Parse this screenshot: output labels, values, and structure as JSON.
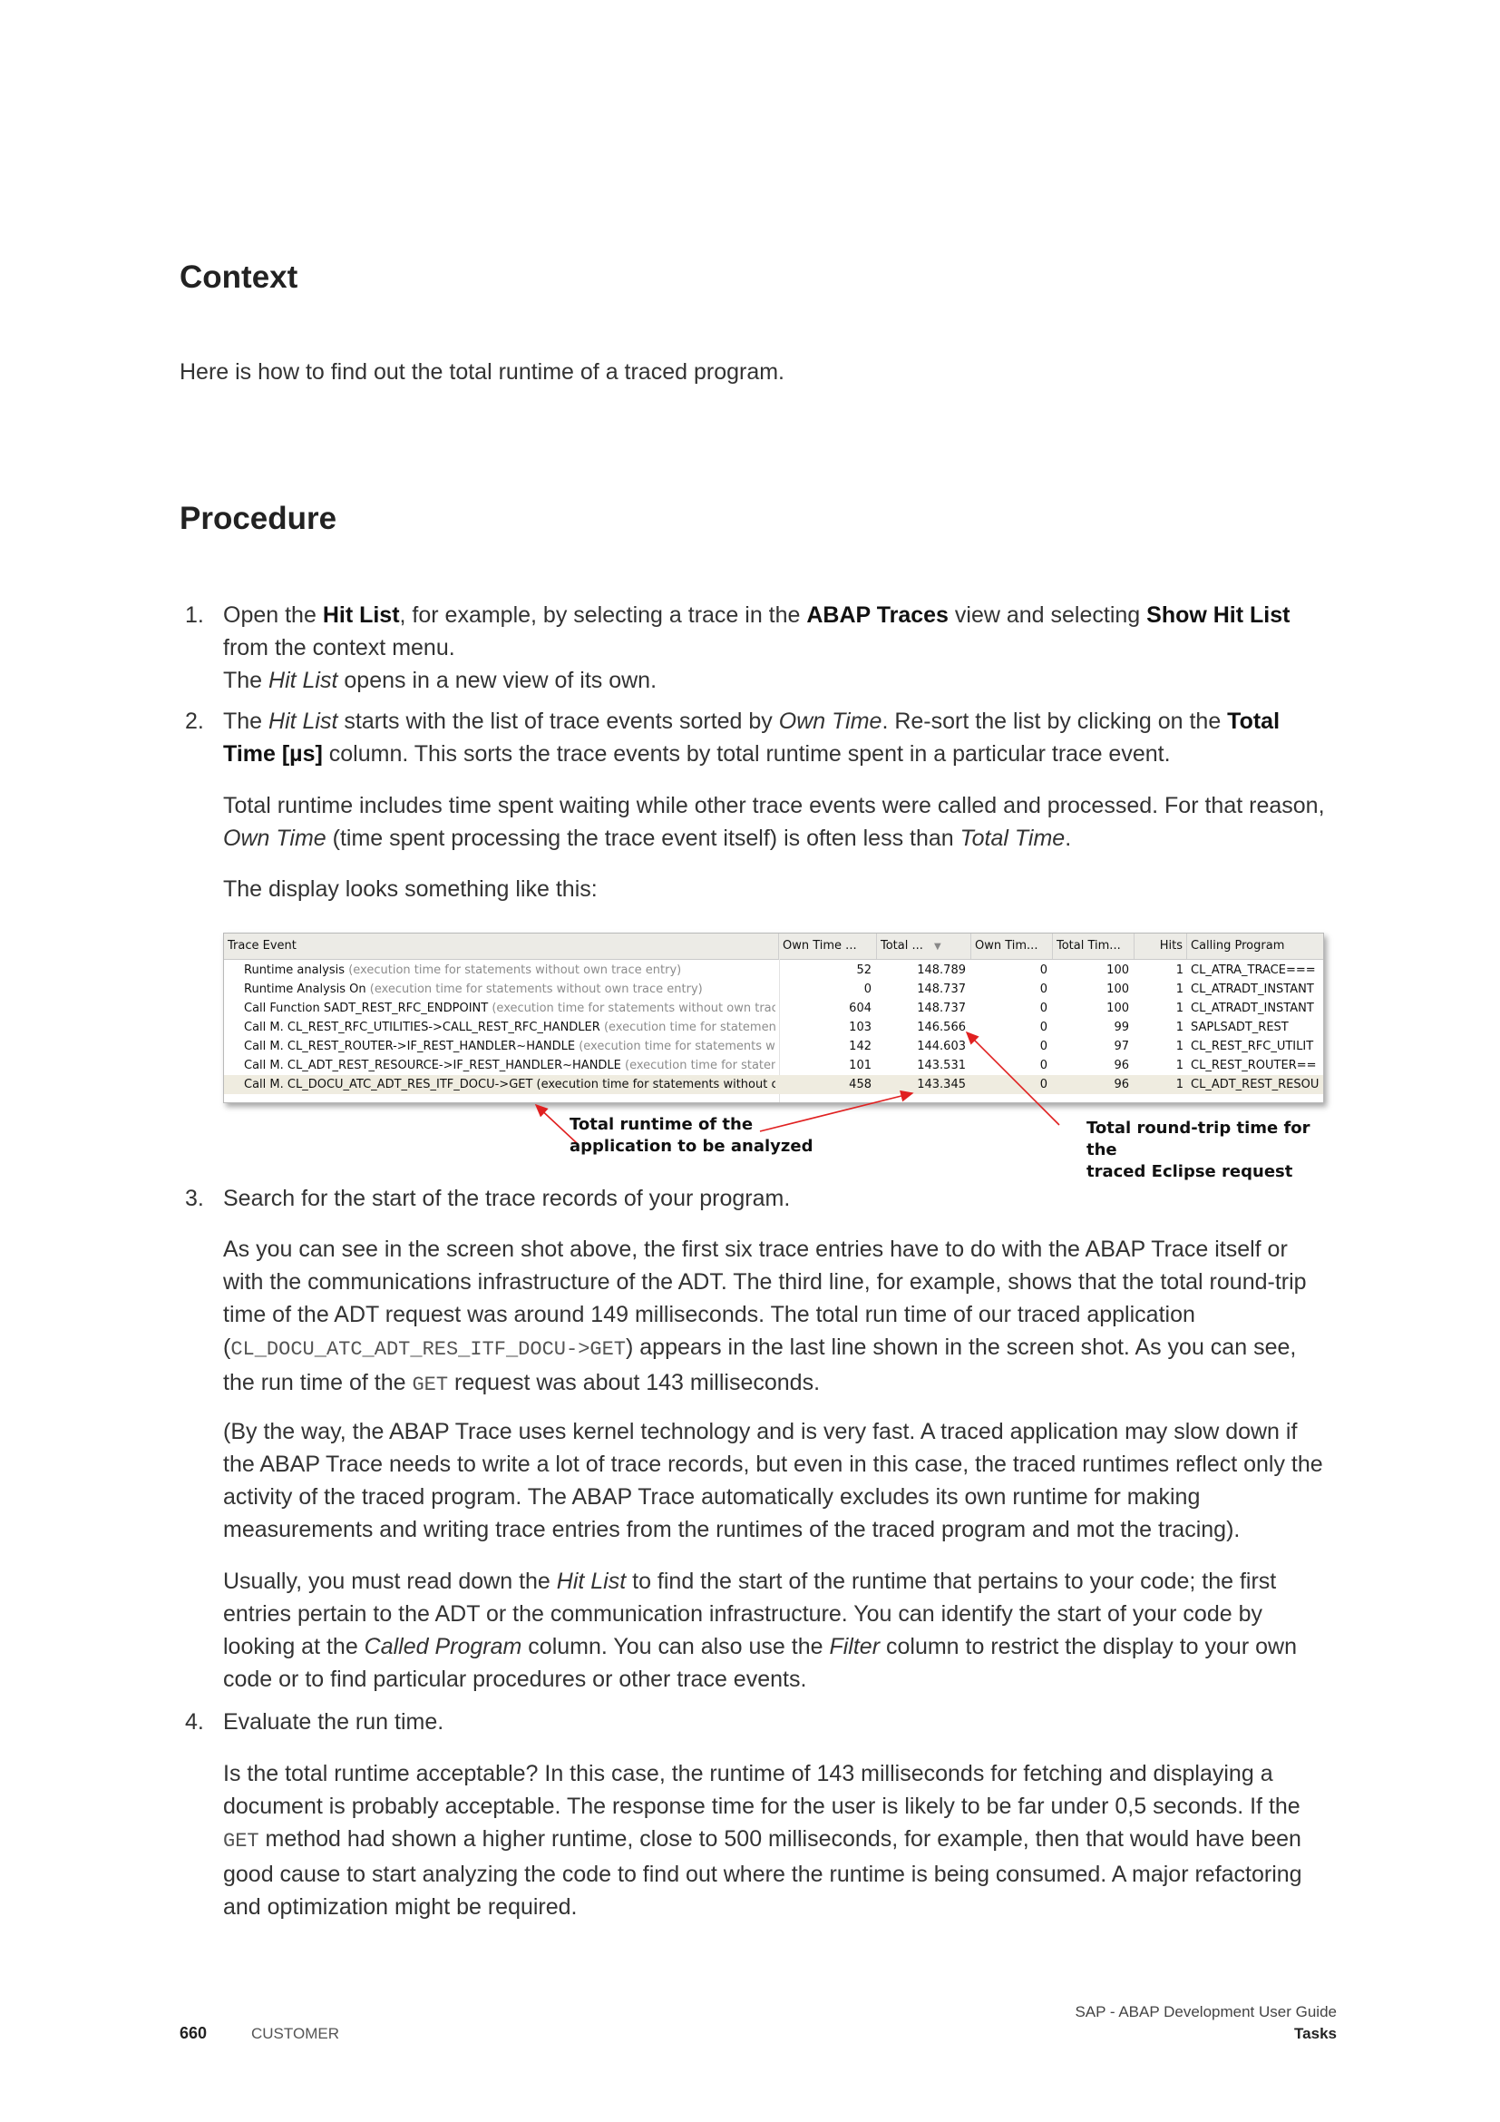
{
  "context": {
    "heading": "Context",
    "text": "Here is how to find out the total runtime of a traced program."
  },
  "procedure": {
    "heading": "Procedure",
    "step1": {
      "num": "1.",
      "a": "Open the ",
      "b1": "Hit List",
      "c": ", for example, by selecting a trace in the ",
      "b2": "ABAP Traces",
      "d": " view and selecting ",
      "b3": "Show Hit List",
      "e": " from the context menu.",
      "line2a": "The ",
      "line2i": "Hit List",
      "line2b": " opens in a new view of its own."
    },
    "step2": {
      "num": "2.",
      "a": "The ",
      "i1": "Hit List",
      "b": " starts with the list of trace events sorted by ",
      "i2": "Own Time",
      "c": ". Re-sort the list by clicking on the ",
      "b1": "Total Time [µs]",
      "d": " column. This sorts the trace events by total runtime spent in a particular trace event.",
      "p2a": "Total runtime includes time spent waiting while other trace events were called and processed. For that reason, ",
      "p2i1": "Own Time",
      "p2b": " (time spent processing the trace event itself) is often less than ",
      "p2i2": "Total Time",
      "p2c": ".",
      "p3": "The display looks something like this:"
    },
    "step3": {
      "num": "3.",
      "title": "Search for the start of the trace records of your program.",
      "p1a": "As you can see in the screen shot above, the first six trace entries have to do with the ABAP Trace itself or with the communications infrastructure of the ADT. The third line, for example, shows that the total round-trip time of the ADT request was around 149 milliseconds. The total run time of our traced application (",
      "p1code": "CL_DOCU_ATC_ADT_RES_ITF_DOCU->GET",
      "p1b": ") appears in the last line shown in the screen shot. As you can see, the run time of the ",
      "p1code2": "GET",
      "p1c": " request was about 143 milliseconds.",
      "p2": "(By the way, the ABAP Trace uses kernel technology and is very fast. A traced application may slow down if the ABAP Trace needs to write a lot of trace records, but even in this case, the traced runtimes reflect only the activity of the traced program. The ABAP Trace automatically excludes its own runtime for making measurements and writing trace entries from the runtimes of the traced program and mot the tracing).",
      "p3a": "Usually, you must read down the ",
      "p3i1": "Hit List",
      "p3b": " to find the start of the runtime that pertains to your code; the first entries pertain to the ADT or the communication infrastructure. You can identify the start of your code by looking at the ",
      "p3i2": "Called Program",
      "p3c": " column. You can also use the ",
      "p3i3": "Filter",
      "p3d": " column to restrict the display to your own code or to find particular procedures or other trace events."
    },
    "step4": {
      "num": "4.",
      "title": "Evaluate the run time.",
      "p1a": "Is the total runtime acceptable? In this case, the runtime of 143 milliseconds for fetching and displaying a document is probably acceptable. The response time for the user is likely to be far under 0,5 seconds. If the ",
      "p1code": "GET",
      "p1b": " method had shown a higher runtime, close to 500 milliseconds, for example, then that would have been good cause to start analyzing the code to find out where the runtime is being consumed. A major refactoring and optimization might be required."
    }
  },
  "screenshot": {
    "headers": [
      "Trace Event",
      "Own Time ...",
      "Total ...",
      "Own Tim...",
      "Total Tim...",
      "Hits",
      "Calling Program"
    ],
    "sort_icon": "sort-descending-icon",
    "rows": [
      {
        "event": "Runtime analysis",
        "note": "(execution time for statements without own trace entry)",
        "own": "52",
        "total": "148.789",
        "own2": "0",
        "total2": "100",
        "hits": "1",
        "prog": "CL_ATRA_TRACE==="
      },
      {
        "event": "Runtime Analysis On",
        "note": "(execution time for statements without own trace entry)",
        "own": "0",
        "total": "148.737",
        "own2": "0",
        "total2": "100",
        "hits": "1",
        "prog": "CL_ATRADT_INSTANT"
      },
      {
        "event": "Call Function  SADT_REST_RFC_ENDPOINT",
        "note": "(execution time for statements without own trace",
        "own": "604",
        "total": "148.737",
        "own2": "0",
        "total2": "100",
        "hits": "1",
        "prog": "CL_ATRADT_INSTANT"
      },
      {
        "event": "Call M.  CL_REST_RFC_UTILITIES->CALL_REST_RFC_HANDLER",
        "note": "(execution time for statemen",
        "own": "103",
        "total": "146.566",
        "own2": "0",
        "total2": "99",
        "hits": "1",
        "prog": "SAPLSADT_REST"
      },
      {
        "event": "Call M.  CL_REST_ROUTER->IF_REST_HANDLER~HANDLE",
        "note": "(execution time for statements wit",
        "own": "142",
        "total": "144.603",
        "own2": "0",
        "total2": "97",
        "hits": "1",
        "prog": "CL_REST_RFC_UTILIT"
      },
      {
        "event": "Call M.  CL_ADT_REST_RESOURCE->IF_REST_HANDLER~HANDLE",
        "note": "(execution time for statem",
        "own": "101",
        "total": "143.531",
        "own2": "0",
        "total2": "96",
        "hits": "1",
        "prog": "CL_REST_ROUTER=="
      },
      {
        "event": "Call M.  CL_DOCU_ATC_ADT_RES_ITF_DOCU->GET (execution time for statements without c",
        "note": "",
        "own": "458",
        "total": "143.345",
        "own2": "0",
        "total2": "96",
        "hits": "1",
        "prog": "CL_ADT_REST_RESOU"
      }
    ],
    "callout_left": [
      "Total runtime of the",
      "application to be analyzed"
    ],
    "callout_right": [
      "Total round-trip time for the",
      "traced Eclipse request"
    ],
    "arrow_color": "#e02020"
  },
  "footer": {
    "page": "660",
    "label": "CUSTOMER",
    "title": "SAP - ABAP Development User Guide",
    "section": "Tasks"
  }
}
